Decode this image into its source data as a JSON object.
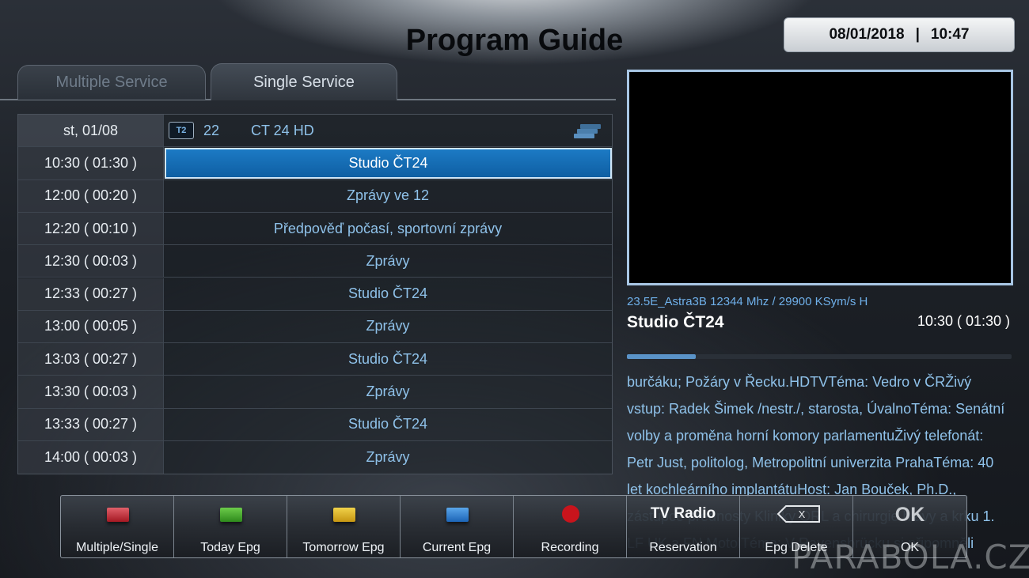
{
  "header": {
    "title": "Program Guide",
    "date": "08/01/2018",
    "separator": "|",
    "time": "10:47"
  },
  "tabs": [
    {
      "label": "Multiple Service",
      "active": false
    },
    {
      "label": "Single Service",
      "active": true
    }
  ],
  "guide": {
    "date": "st, 01/08",
    "channel_badge": "T2",
    "channel_number": "22",
    "channel_name": "CT 24 HD",
    "rows": [
      {
        "time": "10:30 ( 01:30 )",
        "program": "Studio ČT24",
        "selected": true
      },
      {
        "time": "12:00 ( 00:20 )",
        "program": "Zprávy ve 12"
      },
      {
        "time": "12:20 ( 00:10 )",
        "program": "Předpověď počasí, sportovní zprávy"
      },
      {
        "time": "12:30 ( 00:03 )",
        "program": "Zprávy"
      },
      {
        "time": "12:33 ( 00:27 )",
        "program": "Studio ČT24"
      },
      {
        "time": "13:00 ( 00:05 )",
        "program": "Zprávy"
      },
      {
        "time": "13:03 ( 00:27 )",
        "program": "Studio ČT24"
      },
      {
        "time": "13:30 ( 00:03 )",
        "program": "Zprávy"
      },
      {
        "time": "13:33 ( 00:27 )",
        "program": "Studio ČT24"
      },
      {
        "time": "14:00 ( 00:03 )",
        "program": "Zprávy"
      }
    ]
  },
  "info": {
    "transponder": "23.5E_Astra3B  12344 Mhz / 29900 KSym/s H",
    "title": "Studio ČT24",
    "time": "10:30 ( 01:30 )",
    "progress_fraction": 0.18,
    "description": "burčáku; Požáry v Řecku.HDTVTéma: Vedro v ČRŽivý vstup: Radek Šimek  /nestr./, starosta, ÚvalnoTéma: Senátní volby a proměna horní komory parlamentuŽivý telefonát: Petr Just, politolog, Metropolitní univerzita PrahaTéma: 40 let kochleárního implantátuHost: Jan Bouček, Ph.D., zástupce přednosty Kliniky ORL a chirurgie hlavy a krku 1. LF UK a FN MotolTéma: V Ravensbrücku si připomněli padlé"
  },
  "buttons": [
    {
      "label": "Multiple/Single",
      "icon": "red-key-icon"
    },
    {
      "label": "Today Epg",
      "icon": "green-key-icon"
    },
    {
      "label": "Tomorrow Epg",
      "icon": "yellow-key-icon"
    },
    {
      "label": "Current Epg",
      "icon": "blue-key-icon"
    },
    {
      "label": "Recording",
      "icon": "record-dot-icon"
    },
    {
      "label": "Reservation",
      "icon": "tv-radio-icon",
      "glyph": "TV Radio"
    },
    {
      "label": "Epg Delete",
      "icon": "backspace-icon",
      "glyph": "X"
    },
    {
      "label": "OK",
      "icon": "ok-icon",
      "glyph": "OK"
    }
  ],
  "watermark": "PARABOLA.CZ",
  "colors": {
    "selection": "#1670b8",
    "accent_text": "#8fc2ea",
    "preview_border": "#a8c6e4"
  }
}
